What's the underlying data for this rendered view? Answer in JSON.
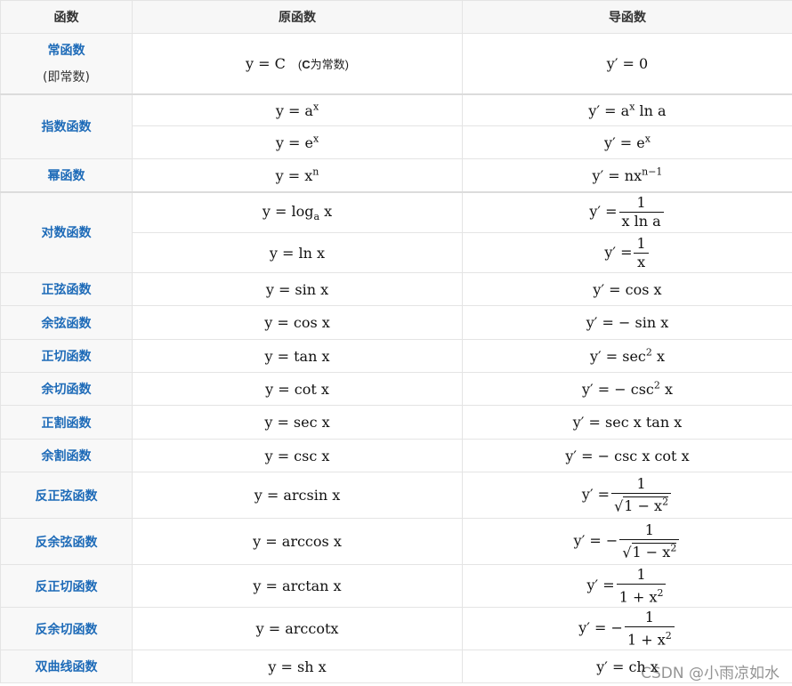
{
  "header": {
    "col1": "函数",
    "col2": "原函数",
    "col3": "导函数"
  },
  "rows": [
    {
      "name": "常函数",
      "name_sub": "(即常数)",
      "orig": "y = C",
      "note": "为常数)",
      "note_c": "C",
      "note_open": "(",
      "deriv": "y′ = 0"
    },
    {
      "name": "指数函数"
    },
    {
      "name": "幂函数"
    },
    {
      "name": "对数函数"
    },
    {
      "name": "正弦函数"
    },
    {
      "name": "余弦函数"
    },
    {
      "name": "正切函数"
    },
    {
      "name": "余切函数"
    },
    {
      "name": "正割函数"
    },
    {
      "name": "余割函数"
    },
    {
      "name": "反正弦函数"
    },
    {
      "name": "反余弦函数"
    },
    {
      "name": "反正切函数"
    },
    {
      "name": "反余切函数"
    },
    {
      "name": "双曲线函数"
    }
  ],
  "formulas": {
    "exp1_orig_base": "y = a",
    "exp1_orig_sup": "x",
    "exp1_deriv_a": "y′ = a",
    "exp1_deriv_sup": "x",
    "exp1_deriv_b": " ln a",
    "exp2_orig_base": "y = e",
    "exp2_orig_sup": "x",
    "exp2_deriv_base": "y′ = e",
    "exp2_deriv_sup": "x",
    "pow_orig_base": "y = x",
    "pow_orig_sup": "n",
    "pow_deriv_base": "y′ = nx",
    "pow_deriv_sup": "n−1",
    "log1_orig_a": "y = log",
    "log1_orig_sub": "a",
    "log1_orig_b": " x",
    "log1_deriv_lhs": "y′ =",
    "log1_deriv_num": "1",
    "log1_deriv_den": "x ln a",
    "log2_orig": "y = ln x",
    "log2_deriv_lhs": "y′ =",
    "log2_deriv_num": "1",
    "log2_deriv_den": "x",
    "sin_orig": "y = sin x",
    "sin_deriv": "y′ = cos x",
    "cos_orig": "y = cos x",
    "cos_deriv": "y′ = − sin x",
    "tan_orig": "y = tan x",
    "tan_deriv_a": "y′ = sec",
    "tan_deriv_sup": "2",
    "tan_deriv_b": " x",
    "cot_orig": "y = cot x",
    "cot_deriv_a": "y′ = − csc",
    "cot_deriv_sup": "2",
    "cot_deriv_b": " x",
    "sec_orig": "y = sec x",
    "sec_deriv": "y′ = sec x tan x",
    "csc_orig": "y = csc x",
    "csc_deriv": "y′ = − csc x cot x",
    "asin_orig": "y = arcsin x",
    "asin_lhs": "y′ =",
    "asin_num": "1",
    "asin_den_a": "1 − x",
    "asin_den_sup": "2",
    "acos_orig": "y = arccos x",
    "acos_lhs": "y′ = −",
    "acos_num": "1",
    "acos_den_a": "1 − x",
    "acos_den_sup": "2",
    "atan_orig": "y = arctan x",
    "atan_lhs": "y′ =",
    "atan_num": "1",
    "atan_den_a": "1 + x",
    "atan_den_sup": "2",
    "acot_orig": "y = arccotx",
    "acot_lhs": "y′ = −",
    "acot_num": "1",
    "acot_den_a": "1 + x",
    "acot_den_sup": "2",
    "sh_orig": "y = sh x",
    "sh_deriv": "y′ = ch x"
  },
  "watermark": "CSDN @小雨凉如水"
}
